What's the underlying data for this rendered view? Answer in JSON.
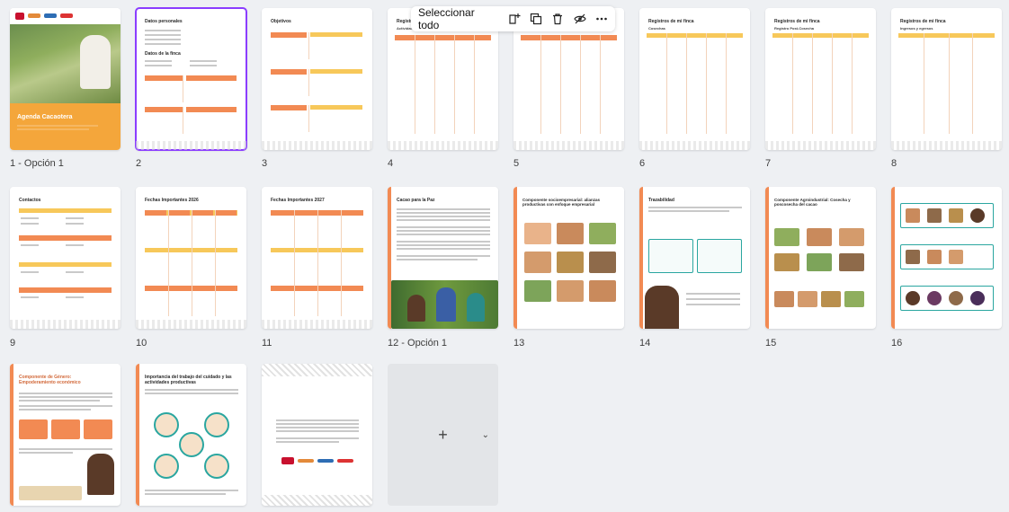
{
  "toolbar": {
    "select_all": "Seleccionar todo",
    "icons": [
      "add-page-icon",
      "duplicate-icon",
      "trash-icon",
      "hide-icon",
      "more-icon"
    ]
  },
  "pages": [
    {
      "label": "1 - Opción 1",
      "title": "Agenda Cacaotera"
    },
    {
      "label": "2",
      "title": "Datos personales",
      "title2": "Datos de la finca"
    },
    {
      "label": "3",
      "title": "Objetivos"
    },
    {
      "label": "4",
      "title": "Registros de mi finca",
      "title2": "Actividades"
    },
    {
      "label": "5",
      "title": ""
    },
    {
      "label": "6",
      "title": "Registros de mi finca",
      "title2": "Cosechas"
    },
    {
      "label": "7",
      "title": "Registros de mi finca",
      "title2": "Registro Post-Cosecha"
    },
    {
      "label": "8",
      "title": "Registros de mi finca",
      "title2": "Ingresos y egresos"
    },
    {
      "label": "9",
      "title": "Contactos"
    },
    {
      "label": "10",
      "title": "Fechas Importantes 2026"
    },
    {
      "label": "11",
      "title": "Fechas Importantes 2027"
    },
    {
      "label": "12 - Opción 1",
      "title": "Cacao para la Paz"
    },
    {
      "label": "13",
      "title": "Componente socioempresarial: alianzas productivas con enfoque empresarial"
    },
    {
      "label": "14",
      "title": "Trazabilidad"
    },
    {
      "label": "15",
      "title": "Componente Agroindustrial: Cosecha y poscosecha del cacao"
    },
    {
      "label": "16",
      "title": ""
    },
    {
      "label": "",
      "title": "Componente de Género: Empoderamiento económico"
    },
    {
      "label": "",
      "title": "Importancia del trabajo del cuidado y las actividades productivas"
    },
    {
      "label": "",
      "title": ""
    }
  ],
  "add_page": {
    "plus": "+",
    "chevron": "⌄"
  },
  "colors": {
    "accent": "#f28a53",
    "yellow": "#f7c85a",
    "selected": "#8b3dff",
    "teal": "#2aa6a0"
  }
}
